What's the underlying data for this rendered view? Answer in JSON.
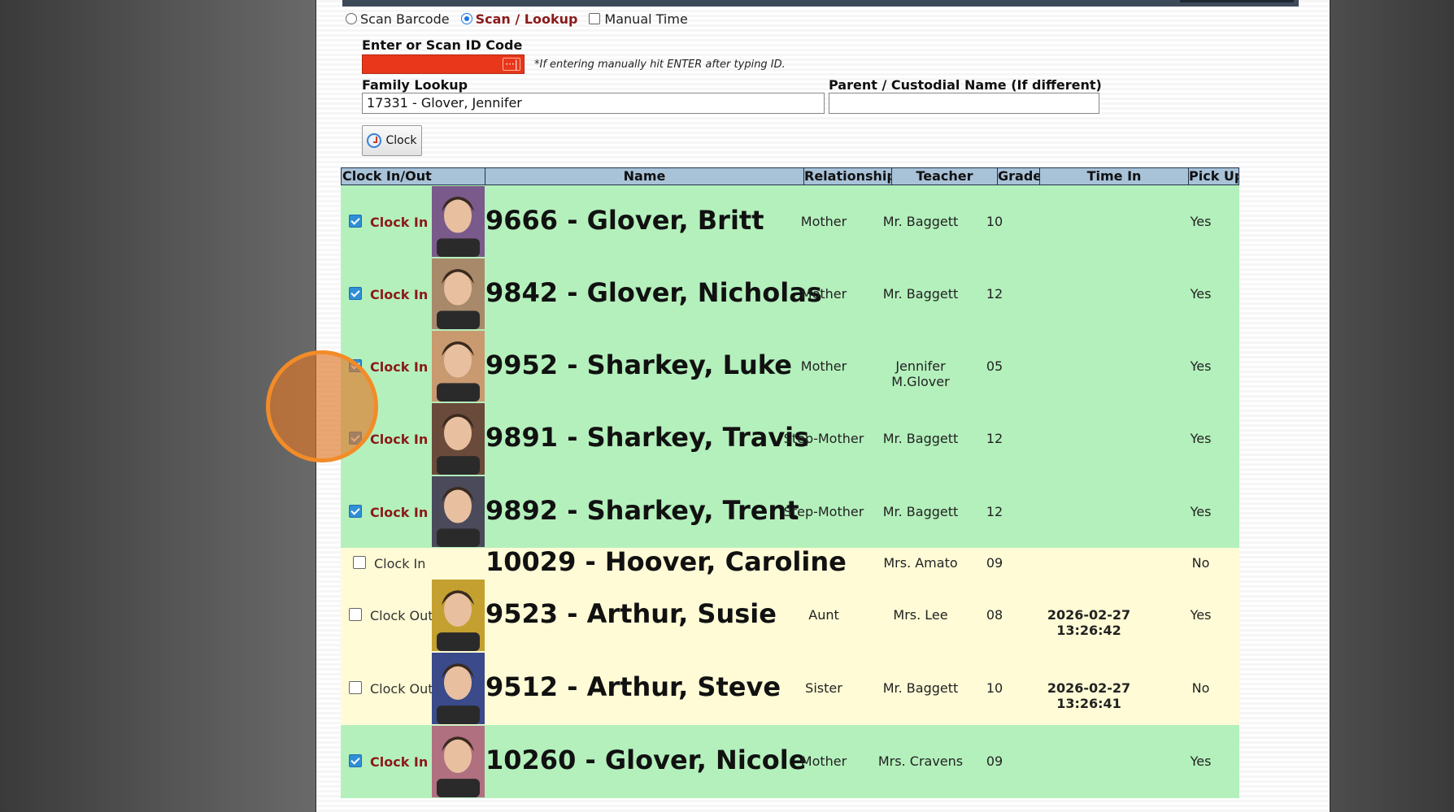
{
  "mode": {
    "scan_barcode": "Scan Barcode",
    "scan_lookup": "Scan / Lookup",
    "manual_time": "Manual Time",
    "selected": "scan_lookup"
  },
  "form": {
    "id_label": "Enter or Scan ID Code",
    "id_value": "",
    "id_hint": "*If entering manually hit ENTER after typing ID.",
    "family_label": "Family Lookup",
    "family_value": "17331 - Glover, Jennifer",
    "parent_label": "Parent / Custodial Name (If different)",
    "parent_value": "",
    "clock_button": "Clock"
  },
  "colors": {
    "id_field": "#e8371a",
    "clock_in_active": "#8b1a1a",
    "row_green": "#b4f0bc",
    "row_yellow": "#fefbd6",
    "header_bg": "#a8c2d8",
    "cursor_ring": "#f28c28"
  },
  "grid": {
    "headers": [
      "Clock In/Out",
      "Name",
      "Relationship",
      "Teacher",
      "Grade",
      "Time In",
      "Pick Up"
    ],
    "rows": [
      {
        "checked": true,
        "action": "Clock In",
        "name": "9666 - Glover, Britt",
        "relationship": "Mother",
        "teacher": "Mr. Baggett",
        "grade": "10",
        "time_in": "",
        "pickup": "Yes",
        "color": "green",
        "photo": true
      },
      {
        "checked": true,
        "action": "Clock In",
        "name": "9842 - Glover, Nicholas",
        "relationship": "Mother",
        "teacher": "Mr. Baggett",
        "grade": "12",
        "time_in": "",
        "pickup": "Yes",
        "color": "green",
        "photo": true
      },
      {
        "checked": true,
        "action": "Clock In",
        "name": "9952 - Sharkey, Luke",
        "relationship": "Mother",
        "teacher": "Jennifer M.Glover",
        "grade": "05",
        "time_in": "",
        "pickup": "Yes",
        "color": "green",
        "photo": true
      },
      {
        "checked": true,
        "action": "Clock In",
        "name": "9891 - Sharkey, Travis",
        "relationship": "Step-Mother",
        "teacher": "Mr. Baggett",
        "grade": "12",
        "time_in": "",
        "pickup": "Yes",
        "color": "green",
        "photo": true
      },
      {
        "checked": true,
        "action": "Clock In",
        "name": "9892 - Sharkey, Trent",
        "relationship": "Step-Mother",
        "teacher": "Mr. Baggett",
        "grade": "12",
        "time_in": "",
        "pickup": "Yes",
        "color": "green",
        "photo": true
      },
      {
        "checked": false,
        "action": "Clock In",
        "name": "10029 - Hoover, Caroline",
        "relationship": "",
        "teacher": "Mrs. Amato",
        "grade": "09",
        "time_in": "",
        "pickup": "No",
        "color": "yellow",
        "photo": false
      },
      {
        "checked": false,
        "action": "Clock Out",
        "name": "9523 - Arthur, Susie",
        "relationship": "Aunt",
        "teacher": "Mrs. Lee",
        "grade": "08",
        "time_in": "2026-02-27 13:26:42",
        "pickup": "Yes",
        "color": "yellow",
        "photo": true
      },
      {
        "checked": false,
        "action": "Clock Out",
        "name": "9512 - Arthur, Steve",
        "relationship": "Sister",
        "teacher": "Mr. Baggett",
        "grade": "10",
        "time_in": "2026-02-27 13:26:41",
        "pickup": "No",
        "color": "yellow",
        "photo": true
      },
      {
        "checked": true,
        "action": "Clock In",
        "name": "10260 - Glover, Nicole",
        "relationship": "Mother",
        "teacher": "Mrs. Cravens",
        "grade": "09",
        "time_in": "",
        "pickup": "Yes",
        "color": "green",
        "photo": true
      }
    ]
  }
}
